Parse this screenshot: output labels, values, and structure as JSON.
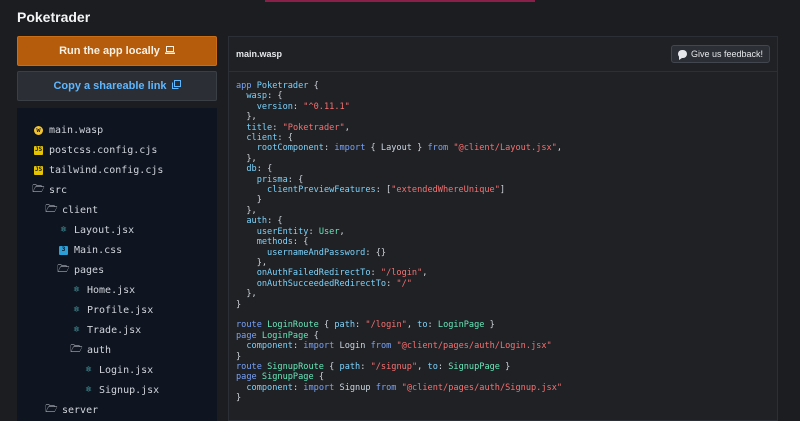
{
  "app": {
    "title": "Poketrader"
  },
  "buttons": {
    "run_label": "Run the app locally",
    "share_label": "Copy a shareable link",
    "feedback_label": "Give us feedback!"
  },
  "icons": {
    "run": "laptop-icon",
    "share": "copy-icon",
    "feedback": "chat-bubble-icon"
  },
  "file_tree": [
    {
      "name": "main.wasp",
      "icon": "wasp-icon",
      "depth": 0
    },
    {
      "name": "postcss.config.cjs",
      "icon": "js-file-icon",
      "depth": 0
    },
    {
      "name": "tailwind.config.cjs",
      "icon": "js-file-icon",
      "depth": 0
    },
    {
      "name": "src",
      "icon": "folder-open-icon",
      "depth": 0
    },
    {
      "name": "client",
      "icon": "folder-open-icon",
      "depth": 1
    },
    {
      "name": "Layout.jsx",
      "icon": "react-icon",
      "depth": 2
    },
    {
      "name": "Main.css",
      "icon": "css-file-icon",
      "depth": 2
    },
    {
      "name": "pages",
      "icon": "folder-open-icon",
      "depth": 2
    },
    {
      "name": "Home.jsx",
      "icon": "react-icon",
      "depth": 3
    },
    {
      "name": "Profile.jsx",
      "icon": "react-icon",
      "depth": 3
    },
    {
      "name": "Trade.jsx",
      "icon": "react-icon",
      "depth": 3
    },
    {
      "name": "auth",
      "icon": "folder-open-icon",
      "depth": 3
    },
    {
      "name": "Login.jsx",
      "icon": "react-icon",
      "depth": 4
    },
    {
      "name": "Signup.jsx",
      "icon": "react-icon",
      "depth": 4
    },
    {
      "name": "server",
      "icon": "folder-open-icon",
      "depth": 1
    }
  ],
  "editor": {
    "filename": "main.wasp",
    "code": {
      "app_kw": "app",
      "app_name": "Poketrader",
      "wasp_key": "wasp",
      "version_key": "version",
      "version_val": "\"^0.11.1\"",
      "title_key": "title",
      "title_val": "\"Poketrader\"",
      "client_key": "client",
      "root_key": "rootComponent",
      "import_kw": "import",
      "layout_id": "Layout",
      "from_kw": "from",
      "layout_path": "\"@client/Layout.jsx\"",
      "db_key": "db",
      "prisma_key": "prisma",
      "cpf_key": "clientPreviewFeatures",
      "cpf_val": "\"extendedWhereUnique\"",
      "auth_key": "auth",
      "userentity_key": "userEntity",
      "user_entity": "User",
      "methods_key": "methods",
      "uap_key": "usernameAndPassword",
      "onfail_key": "onAuthFailedRedirectTo",
      "onfail_val": "\"/login\"",
      "onsucc_key": "onAuthSucceededRedirectTo",
      "onsucc_val": "\"/\"",
      "route_kw": "route",
      "page_kw": "page",
      "login_route": "LoginRoute",
      "path_key": "path",
      "login_path": "\"/login\"",
      "to_key": "to",
      "login_page": "LoginPage",
      "component_key": "component",
      "login_id": "Login",
      "login_comp_path": "\"@client/pages/auth/Login.jsx\"",
      "signup_route": "SignupRoute",
      "signup_path": "\"/signup\"",
      "signup_page": "SignupPage",
      "signup_id": "Signup",
      "signup_comp_path": "\"@client/pages/auth/Signup.jsx\""
    }
  },
  "colors": {
    "run_button": "#b45c0c",
    "share_text": "#5fb7ff",
    "keyword": "#7aa2f7",
    "identifier": "#7dd3fc",
    "string": "#f87171",
    "type": "#67e8b9"
  }
}
